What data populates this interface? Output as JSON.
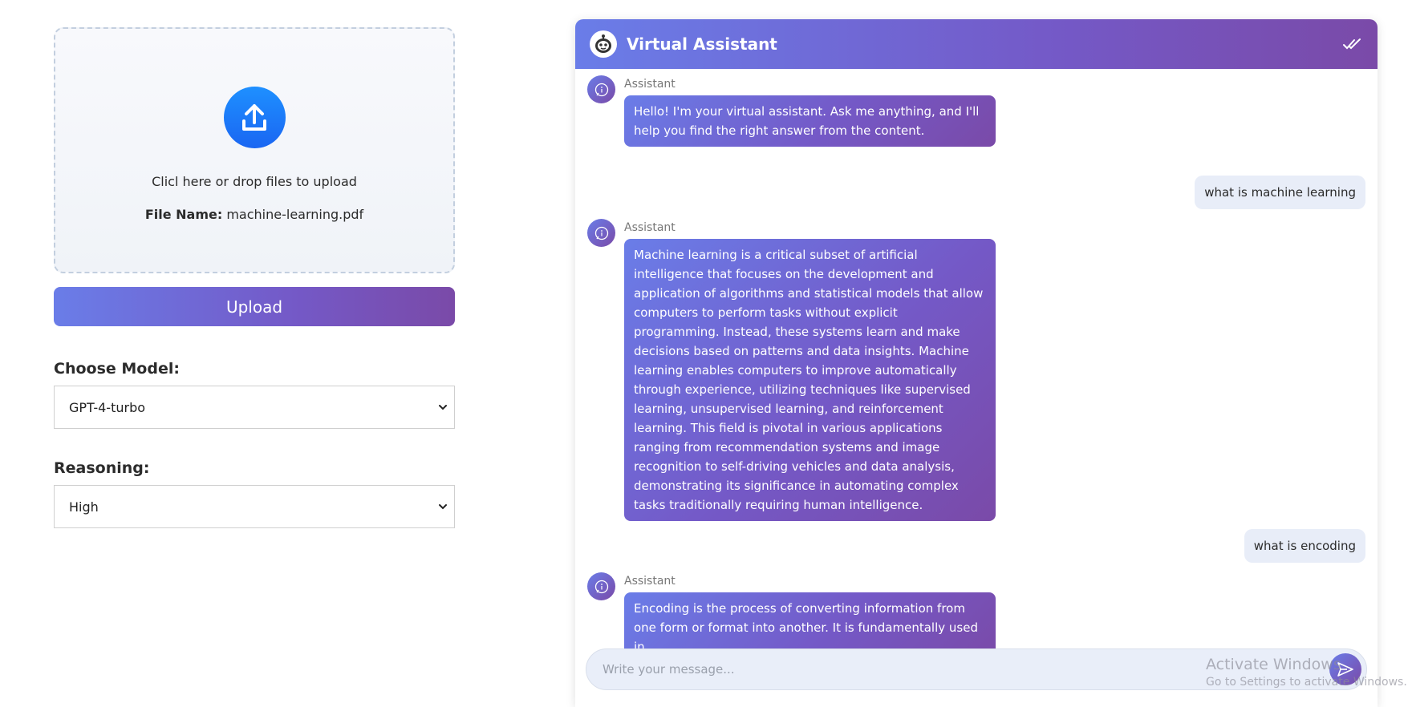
{
  "upload": {
    "icon": "upload-icon",
    "drop_text": "Clicl here or drop files to upload",
    "file_name_label": "File Name:",
    "file_name": "machine-learning.pdf",
    "button_label": "Upload"
  },
  "model": {
    "label": "Choose Model:",
    "selected": "GPT-4-turbo"
  },
  "reasoning": {
    "label": "Reasoning:",
    "selected": "High"
  },
  "chat": {
    "title": "Virtual Assistant",
    "header_icon": "robot-icon",
    "header_action_icon": "double-check-icon",
    "messages": [
      {
        "role": "assistant",
        "name": "Assistant",
        "text": "Hello! I'm your virtual assistant. Ask me anything, and I'll help you find the right answer from the content."
      },
      {
        "role": "user",
        "text": "what is machine learning"
      },
      {
        "role": "assistant",
        "name": "Assistant",
        "text": "Machine learning is a critical subset of artificial intelligence that focuses on the development and application of algorithms and statistical models that allow computers to perform tasks without explicit programming. Instead, these systems learn and make decisions based on patterns and data insights. Machine learning enables computers to improve automatically through experience, utilizing techniques like supervised learning, unsupervised learning, and reinforcement learning. This field is pivotal in various applications ranging from recommendation systems and image recognition to self-driving vehicles and data analysis, demonstrating its significance in automating complex tasks traditionally requiring human intelligence."
      },
      {
        "role": "user",
        "text": "what is encoding"
      },
      {
        "role": "assistant",
        "name": "Assistant",
        "text": "Encoding is the process of converting information from one form or format into another. It is fundamentally used in"
      }
    ],
    "input_placeholder": "Write your message...",
    "send_icon": "send-icon"
  },
  "watermark": {
    "title": "Activate Windows",
    "subtitle": "Go to Settings to activate Windows."
  },
  "colors": {
    "accent_start": "#6a7de8",
    "accent_end": "#7a4aa8",
    "upload_blue": "#1a66f2",
    "user_bubble": "#e8edf8"
  }
}
